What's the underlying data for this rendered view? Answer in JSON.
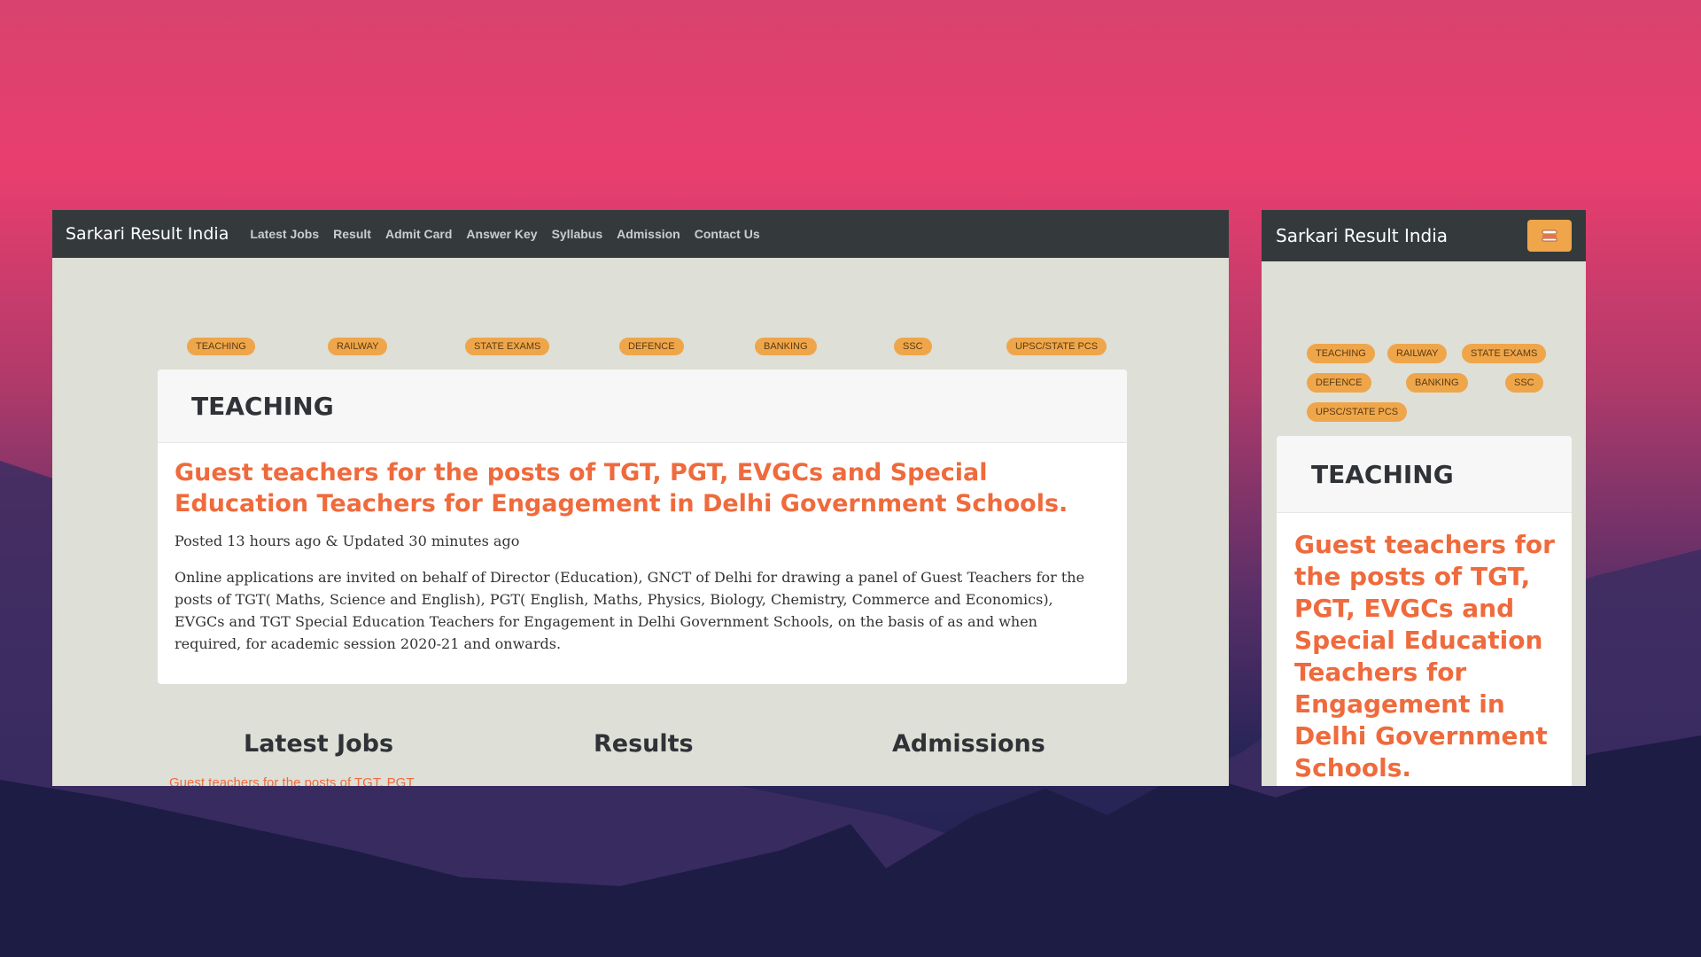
{
  "colors": {
    "accent": "#efa64a",
    "link": "#ef6a3c",
    "navbar": "#343a3c",
    "page_bg": "#dedfd6"
  },
  "desktop": {
    "brand": "Sarkari Result India",
    "nav": [
      "Latest Jobs",
      "Result",
      "Admit Card",
      "Answer Key",
      "Syllabus",
      "Admission",
      "Contact Us"
    ],
    "categories": [
      "TEACHING",
      "RAILWAY",
      "STATE EXAMS",
      "DEFENCE",
      "BANKING",
      "SSC",
      "UPSC/STATE PCS"
    ],
    "card": {
      "heading": "TEACHING",
      "post_title": "Guest teachers for the posts of TGT, PGT, EVGCs and Special Education Teachers for Engagement in Delhi Government Schools.",
      "meta": "Posted 13 hours ago & Updated 30 minutes ago",
      "body": "Online applications are invited on behalf of Director (Education), GNCT of Delhi for drawing a panel of Guest Teachers for the posts of TGT( Maths, Science and English), PGT( English, Maths, Physics, Biology, Chemistry, Commerce and Economics), EVGCs and TGT Special Education Teachers for Engagement in Delhi Government Schools, on the basis of as and when required, for academic session 2020-21 and onwards."
    },
    "sections": [
      "Latest Jobs",
      "Results",
      "Admissions"
    ],
    "latest_jobs_link": "Guest teachers for the posts of TGT, PGT"
  },
  "mobile": {
    "brand": "Sarkari Result India",
    "toggler_icon": "hamburger-icon",
    "categories": [
      "TEACHING",
      "RAILWAY",
      "STATE EXAMS",
      "DEFENCE",
      "BANKING",
      "SSC",
      "UPSC/STATE PCS"
    ],
    "card": {
      "heading": "TEACHING",
      "post_title": "Guest teachers for the posts of TGT, PGT, EVGCs and Special Education Teachers for Engagement in Delhi Government Schools."
    }
  }
}
